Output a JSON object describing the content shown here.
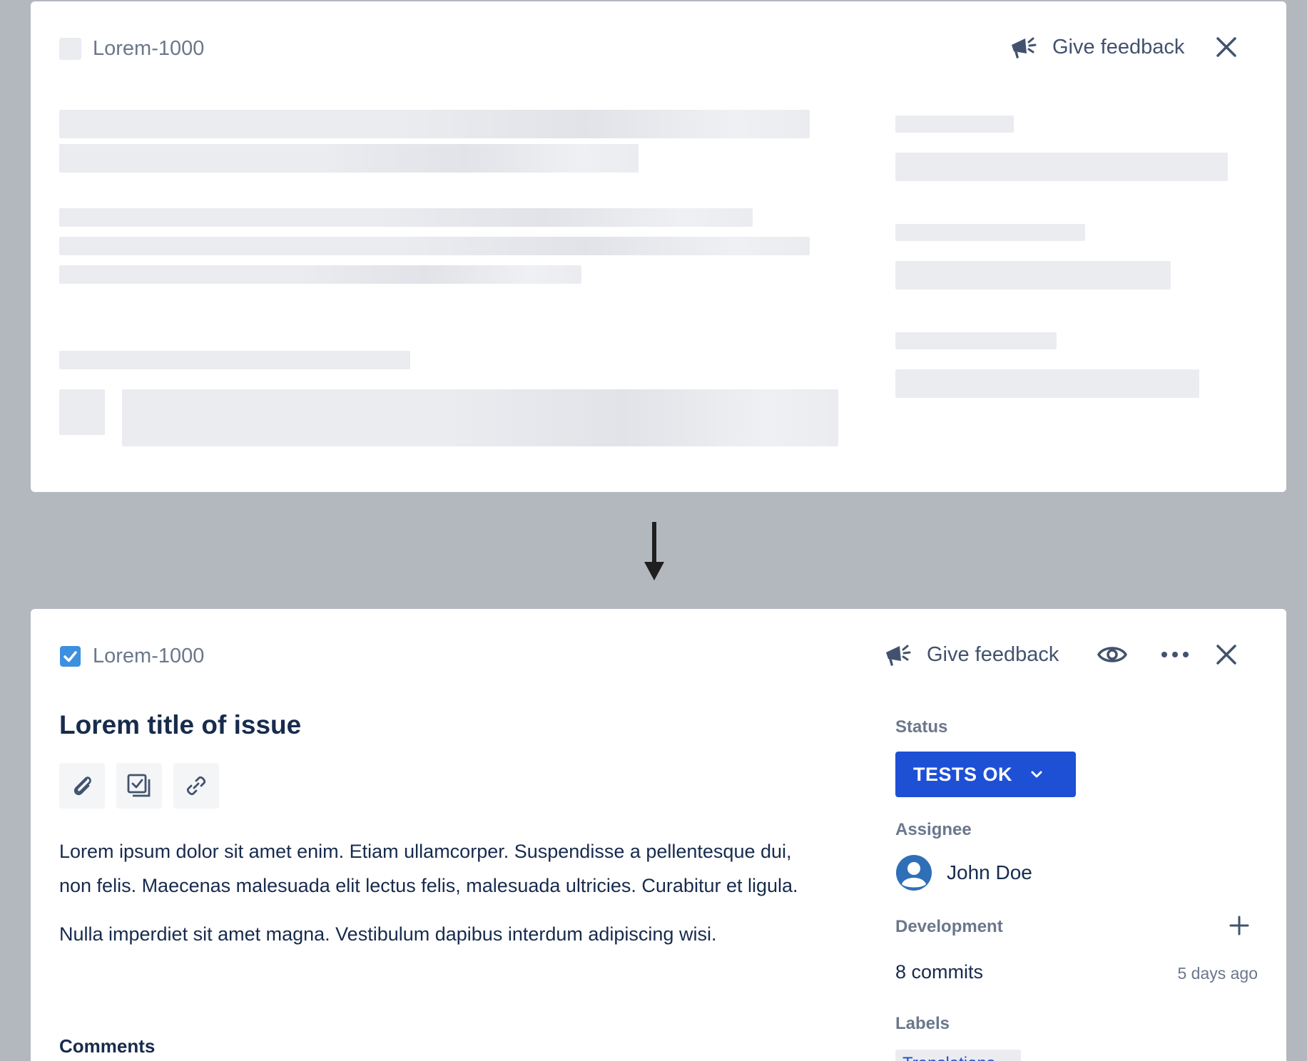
{
  "loading_view": {
    "issue_key": "Lorem-1000",
    "feedback_label": "Give feedback"
  },
  "loaded_view": {
    "issue_key": "Lorem-1000",
    "feedback_label": "Give feedback",
    "title": "Lorem title of issue",
    "quick_actions": [
      "attach-icon",
      "child-issue-icon",
      "link-icon"
    ],
    "description": [
      "Lorem ipsum dolor sit amet enim. Etiam ullamcorper. Suspendisse a pellentesque dui, non felis. Maecenas malesuada elit lectus felis, malesuada ultricies. Curabitur et ligula.",
      "Nulla imperdiet sit amet magna. Vestibulum dapibus interdum adipiscing wisi."
    ],
    "comments_heading": "Comments",
    "sidebar": {
      "status_label": "Status",
      "status_value": "TESTS OK",
      "assignee_label": "Assignee",
      "assignee_name": "John Doe",
      "development_label": "Development",
      "commits": "8 commits",
      "commits_time": "5 days ago",
      "labels_label": "Labels",
      "label_chip": "Translations"
    }
  },
  "colors": {
    "background": "#b3b8bf",
    "status_button": "#1e50d6",
    "checkbox_blue": "#3d8fe0",
    "skeleton": "#ebecf0"
  }
}
